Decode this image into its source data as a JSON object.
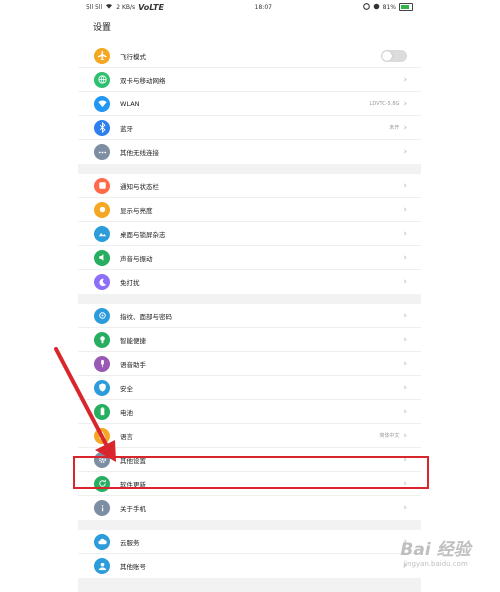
{
  "status": {
    "signal": "5ll 5ll",
    "speed": "2 KB/s",
    "network": "VoLTE",
    "time": "18:07",
    "battery": "81%",
    "battery_level": 0.81
  },
  "title": "设置",
  "items": {
    "airplane": {
      "label": "飞行模式"
    },
    "dual_sim": {
      "label": "双卡与移动网络"
    },
    "wlan": {
      "label": "WLAN",
      "value": "LDVTC-5.8G"
    },
    "bluetooth": {
      "label": "蓝牙",
      "value": "未开"
    },
    "wireless": {
      "label": "其他无线连接"
    },
    "notification": {
      "label": "通知与状态栏"
    },
    "display": {
      "label": "显示与亮度"
    },
    "wallpaper": {
      "label": "桌面与锁屏杂志"
    },
    "sound": {
      "label": "声音与振动"
    },
    "dnd": {
      "label": "免打扰"
    },
    "fingerprint": {
      "label": "指纹、面部与密码"
    },
    "smart": {
      "label": "智能便捷"
    },
    "assistant": {
      "label": "语音助手"
    },
    "security": {
      "label": "安全"
    },
    "battery": {
      "label": "电池"
    },
    "language": {
      "label": "语言",
      "value": "简体中文"
    },
    "other": {
      "label": "其他设置"
    },
    "update": {
      "label": "软件更新"
    },
    "about": {
      "label": "关于手机"
    },
    "cloud": {
      "label": "云服务"
    },
    "account": {
      "label": "其他账号"
    }
  },
  "chevron": "›",
  "watermark": {
    "logo": "Bai 经验",
    "sub": "jingyan.baidu.com"
  },
  "colors": {
    "highlight": "#d8262c",
    "arrow": "#d8262c",
    "airplane": "#f5a623",
    "dual_sim": "#2fbf71",
    "wlan": "#2196f3",
    "bluetooth": "#2f80ed",
    "wireless": "#7d8ea3",
    "notification": "#ff6b4a",
    "display": "#f5a623",
    "wallpaper": "#2d9cdb",
    "sound": "#27ae60",
    "dnd": "#8e6ff7",
    "fingerprint": "#2d9cdb",
    "smart": "#27ae60",
    "assistant": "#9b59b6",
    "security": "#2d9cdb",
    "battery": "#27ae60",
    "language": "#f5a623",
    "other": "#7d8ea3",
    "update": "#27ae60",
    "about": "#7d8ea3",
    "cloud": "#2d9cdb",
    "account": "#2d9cdb"
  }
}
